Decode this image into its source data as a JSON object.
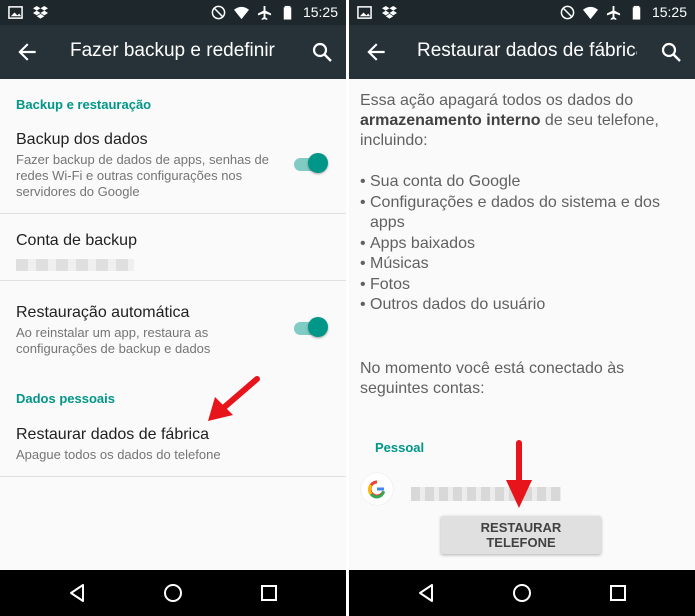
{
  "status_bar": {
    "time": "15:25"
  },
  "left_screen": {
    "title": "Fazer backup e redefinir",
    "section_backup": "Backup e restauração",
    "backup_data": {
      "title": "Backup dos dados",
      "summary": "Fazer backup de dados de apps, senhas de redes Wi-Fi e outras configurações nos servidores do Google",
      "enabled": true
    },
    "backup_account": {
      "title": "Conta de backup"
    },
    "auto_restore": {
      "title": "Restauração automática",
      "summary": "Ao reinstalar um app, restaura as configurações de backup e dados",
      "enabled": true
    },
    "section_personal": "Dados pessoais",
    "factory_reset": {
      "title": "Restaurar dados de fábrica",
      "summary": "Apague todos os dados do telefone"
    }
  },
  "right_screen": {
    "title": "Restaurar dados de fábrica",
    "intro_prefix": "Essa ação apagará todos os dados do ",
    "intro_bold": "armazenamento interno",
    "intro_suffix": " de seu telefone, incluindo:",
    "items": [
      "Sua conta do Google",
      "Configurações e dados do sistema e dos apps",
      "Apps baixados",
      "Músicas",
      "Fotos",
      "Outros dados do usuário"
    ],
    "accounts_text": "No momento você está conectado às seguintes contas:",
    "account_header": "Pessoal",
    "reset_button": "RESTAURAR TELEFONE"
  },
  "colors": {
    "accent": "#009688",
    "toolbar": "#263238",
    "statusbar": "#1e272b",
    "annotation_arrow": "#e8141b"
  },
  "icons": {
    "status_left": [
      "image-icon",
      "dropbox-icon"
    ],
    "status_right": [
      "do-not-disturb-icon",
      "wifi-icon",
      "airplane-icon",
      "battery-icon"
    ],
    "toolbar": [
      "back-arrow-icon",
      "search-icon"
    ],
    "nav": [
      "nav-back-icon",
      "nav-home-icon",
      "nav-recents-icon"
    ]
  }
}
